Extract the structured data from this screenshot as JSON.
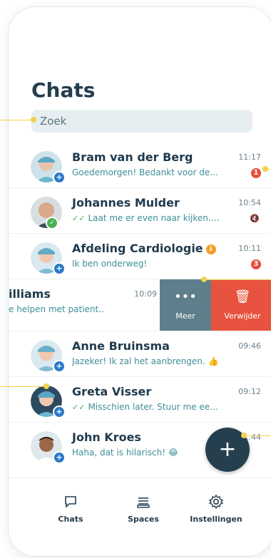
{
  "header": {
    "title": "Chats"
  },
  "search": {
    "placeholder": "Zoek"
  },
  "chats": [
    {
      "name": "Bram van der Berg",
      "message": "Goedemorgen! Bedankt voor de...",
      "time": "11:17",
      "unread": "1",
      "status": "plus"
    },
    {
      "name": "Johannes Mulder",
      "message": "Laat me er even naar kijken. Ik...",
      "time": "10:54",
      "status": "check",
      "read_tick": "✓✓",
      "muted_icon": "mute-icon"
    },
    {
      "name": "Afdeling Cardiologie",
      "message": "Ik ben onderweg!",
      "time": "10:11",
      "unread": "3",
      "status": "plus"
    },
    {
      "name": "illiams",
      "message": "e helpen met patient..",
      "time": "10:09",
      "actions": {
        "more_label": "Meer",
        "delete_label": "Verwijder"
      }
    },
    {
      "name": "Anne Bruinsma",
      "message": "Jazeker! Ik zal het aanbrengen. 👍",
      "time": "09:46",
      "status": "plus"
    },
    {
      "name": "Greta Visser",
      "message": "Misschien later. Stuur me een...",
      "time": "09:12",
      "status": "plus",
      "read_tick": "✓✓"
    },
    {
      "name": "John Kroes",
      "message": "Haha, dat is hilarisch! 😂",
      "time": "...44",
      "status": "plus"
    }
  ],
  "tabs": [
    {
      "label": "Chats",
      "icon": "chats-icon"
    },
    {
      "label": "Spaces",
      "icon": "spaces-icon"
    },
    {
      "label": "Instellingen",
      "icon": "gear-icon"
    }
  ],
  "fab": {
    "icon": "plus-icon",
    "label": "+"
  },
  "colors": {
    "accent": "#263f4f",
    "unread": "#e84b3c",
    "delete": "#e8533f",
    "more": "#5f7e8b",
    "callout": "#f0d24a"
  }
}
